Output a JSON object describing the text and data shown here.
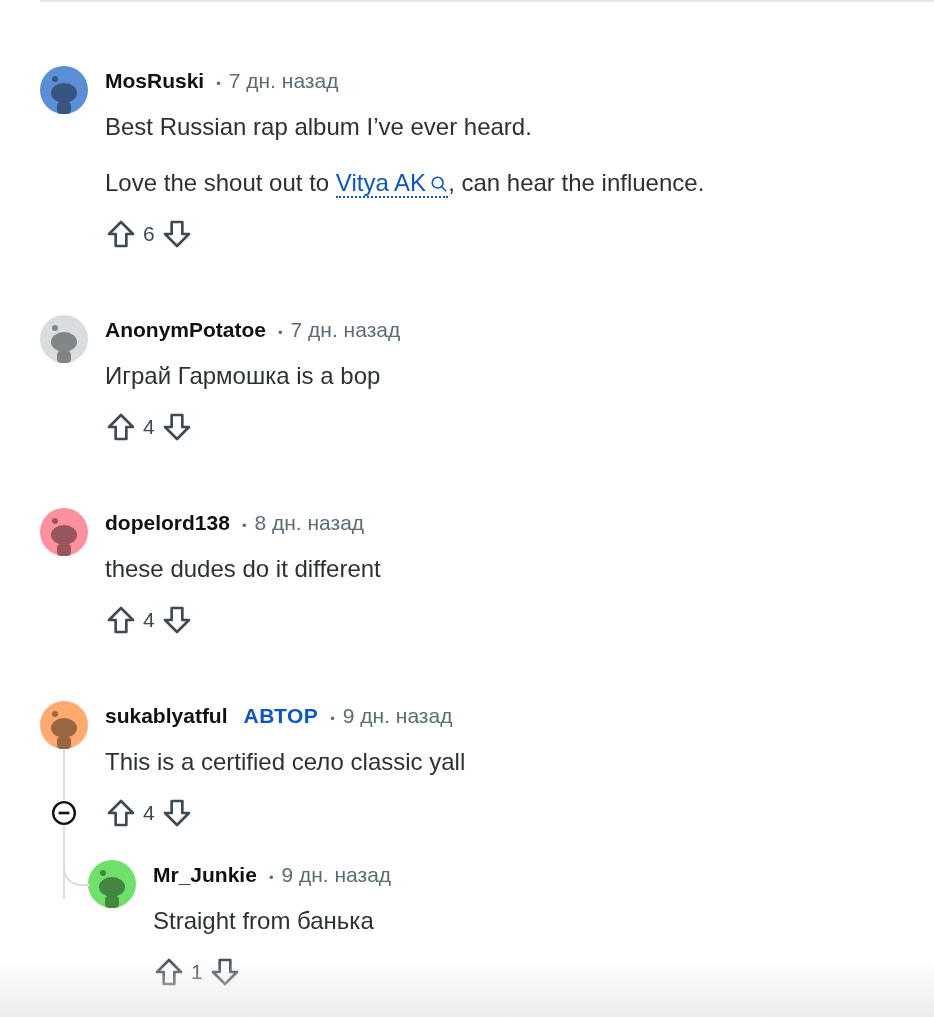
{
  "comments": [
    {
      "author": "MosRuski",
      "separator": "•",
      "avatar": {
        "color": "#5b8ed6"
      },
      "time": "7 дн. назад",
      "paragraphs": [
        [
          {
            "kind": "text",
            "text": "Best Russian rap album I’ve ever heard."
          }
        ],
        [
          {
            "kind": "text",
            "text": "Love the shout out to "
          },
          {
            "kind": "link",
            "text": "Vitya AK"
          },
          {
            "kind": "text",
            "text": ", can hear the influence."
          }
        ]
      ],
      "score": "6"
    },
    {
      "author": "AnonymPotatoe",
      "separator": "•",
      "avatar": {
        "color": "#d9dde0"
      },
      "time": "7 дн. назад",
      "paragraphs": [
        [
          {
            "kind": "text",
            "text": "Играй Гармошка is a bop"
          }
        ]
      ],
      "score": "4"
    },
    {
      "author": "dopelord138",
      "separator": "•",
      "avatar": {
        "color": "#ff909e"
      },
      "time": "8 дн. назад",
      "paragraphs": [
        [
          {
            "kind": "text",
            "text": "these dudes do it different"
          }
        ]
      ],
      "score": "4"
    },
    {
      "author": "sukablyatful",
      "badge": "АВТОР",
      "separator": "•",
      "avatar": {
        "color": "#ffab70"
      },
      "time": "9 дн. назад",
      "paragraphs": [
        [
          {
            "kind": "text",
            "text": "This is a certified село classic yall"
          }
        ]
      ],
      "score": "4",
      "expanded": true,
      "children": [
        {
          "author": "Mr_Junkie",
          "separator": "•",
          "avatar": {
            "color": "#6fe06a"
          },
          "time": "9 дн. назад",
          "paragraphs": [
            [
              {
                "kind": "text",
                "text": "Straight from банька"
              }
            ]
          ],
          "score": "1"
        }
      ]
    }
  ]
}
